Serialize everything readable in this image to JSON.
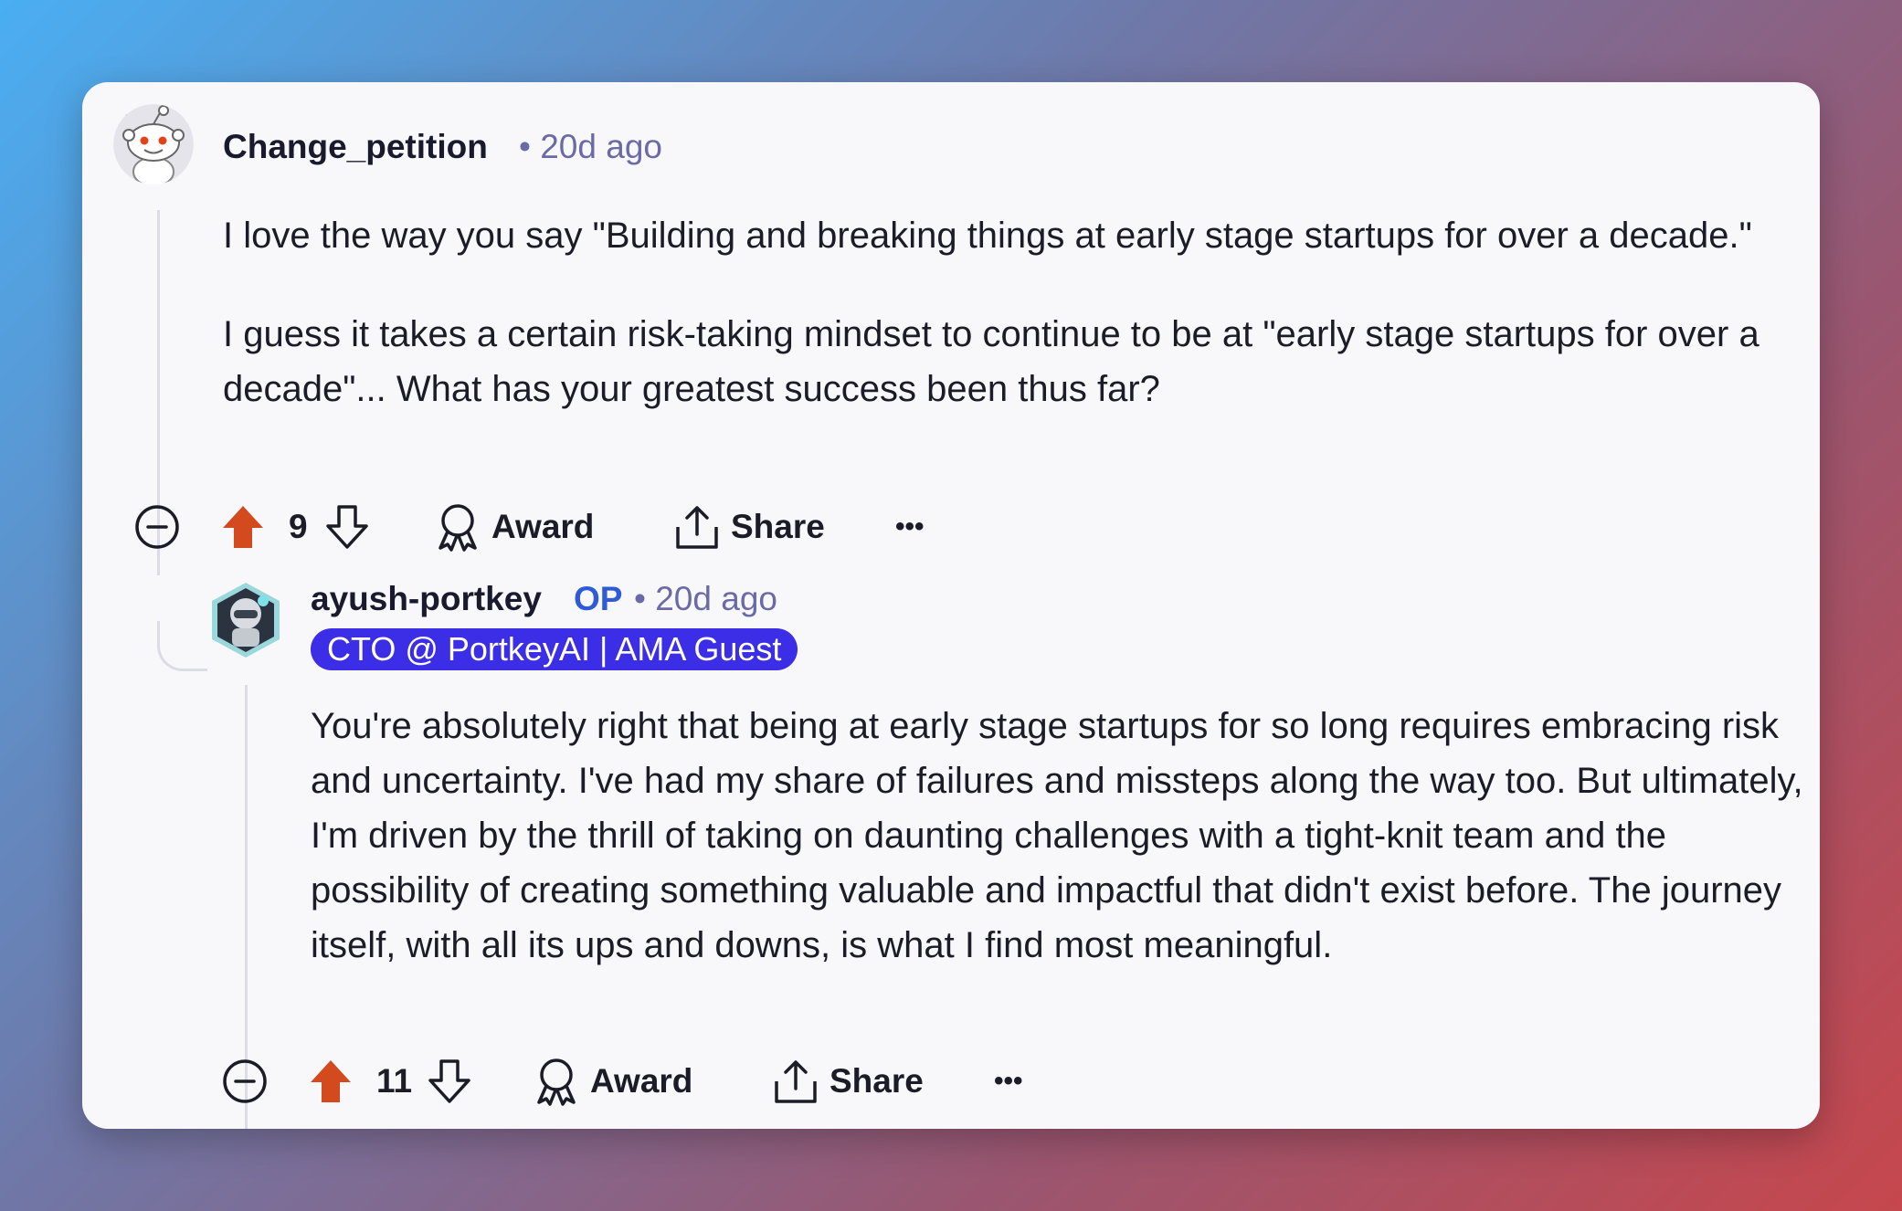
{
  "comment": {
    "username": "Change_petition",
    "time": "• 20d ago",
    "paragraphs": [
      "I love the way you say \"Building and breaking things at early stage startups for over a decade.\"",
      "I guess it takes a certain risk-taking mindset to continue to be at \"early stage startups for over a decade\"... What has your greatest success been thus far?"
    ],
    "votes": "9",
    "award_label": "Award",
    "share_label": "Share",
    "more_label": "•••"
  },
  "reply": {
    "username": "ayush-portkey",
    "op_badge": "OP",
    "time": "• 20d ago",
    "flair": "CTO @ PortkeyAI | AMA Guest",
    "paragraphs": [
      "You're absolutely right that being at early stage startups for so long requires embracing risk and uncertainty. I've had my share of failures and missteps along the way too. But ultimately, I'm driven by the thrill of taking on daunting challenges with a tight-knit team and the possibility of creating something valuable and impactful that didn't exist before. The journey itself, with all its ups and downs, is what I find most meaningful."
    ],
    "votes": "11",
    "award_label": "Award",
    "share_label": "Share",
    "more_label": "•••"
  },
  "icons": {
    "collapse": "collapse-icon",
    "upvote": "upvote-icon",
    "downvote": "downvote-icon",
    "award": "award-icon",
    "share": "share-icon",
    "more": "more-icon"
  },
  "colors": {
    "upvote_active": "#d24a1e",
    "op": "#2f5bd6",
    "flair_bg": "#3b2ee6",
    "meta": "#6a6aa8"
  }
}
